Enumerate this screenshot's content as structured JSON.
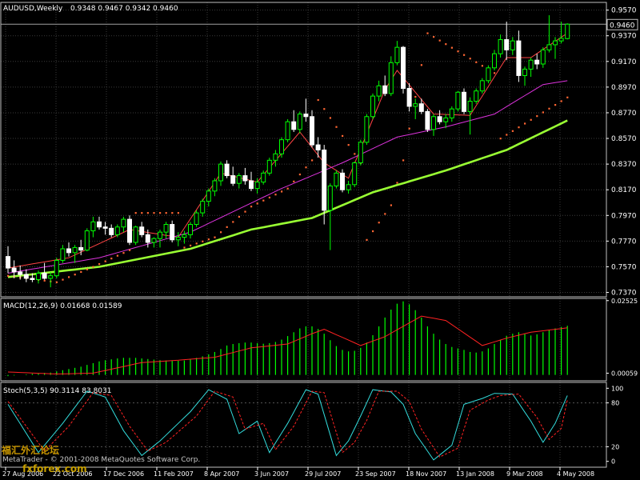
{
  "chart_data": [
    {
      "type": "candlestick",
      "title": "AUDUSD,Weekly",
      "ohlc_text": "0.9348 0.9467 0.9342 0.9460",
      "current_price": 0.946,
      "current_price_label": "0.9460",
      "ylim": [
        0.7336,
        0.963
      ],
      "y_ticks": [
        "0.9570",
        "0.9370",
        "0.9170",
        "0.8970",
        "0.8770",
        "0.8570",
        "0.8370",
        "0.8170",
        "0.7970",
        "0.7770",
        "0.7570",
        "0.7370"
      ],
      "candle_colors": {
        "up": "#00ff00",
        "down": "#ffffff"
      },
      "candles": [
        [
          0.765,
          0.773,
          0.752,
          0.756
        ],
        [
          0.756,
          0.762,
          0.748,
          0.753
        ],
        [
          0.753,
          0.758,
          0.747,
          0.751
        ],
        [
          0.751,
          0.755,
          0.745,
          0.748
        ],
        [
          0.748,
          0.752,
          0.745,
          0.747
        ],
        [
          0.747,
          0.754,
          0.744,
          0.752
        ],
        [
          0.752,
          0.76,
          0.747,
          0.748
        ],
        [
          0.748,
          0.753,
          0.741,
          0.75
        ],
        [
          0.75,
          0.764,
          0.748,
          0.762
        ],
        [
          0.762,
          0.774,
          0.76,
          0.771
        ],
        [
          0.771,
          0.776,
          0.765,
          0.768
        ],
        [
          0.768,
          0.774,
          0.76,
          0.772
        ],
        [
          0.772,
          0.778,
          0.766,
          0.77
        ],
        [
          0.77,
          0.787,
          0.769,
          0.785
        ],
        [
          0.785,
          0.796,
          0.78,
          0.792
        ],
        [
          0.792,
          0.796,
          0.786,
          0.788
        ],
        [
          0.788,
          0.792,
          0.782,
          0.787
        ],
        [
          0.787,
          0.79,
          0.78,
          0.782
        ],
        [
          0.782,
          0.79,
          0.78,
          0.788
        ],
        [
          0.788,
          0.796,
          0.784,
          0.794
        ],
        [
          0.794,
          0.797,
          0.774,
          0.776
        ],
        [
          0.776,
          0.789,
          0.774,
          0.788
        ],
        [
          0.788,
          0.792,
          0.78,
          0.782
        ],
        [
          0.782,
          0.786,
          0.772,
          0.776
        ],
        [
          0.776,
          0.78,
          0.772,
          0.779
        ],
        [
          0.779,
          0.786,
          0.772,
          0.784
        ],
        [
          0.784,
          0.792,
          0.779,
          0.79
        ],
        [
          0.79,
          0.793,
          0.776,
          0.778
        ],
        [
          0.778,
          0.784,
          0.773,
          0.78
        ],
        [
          0.78,
          0.785,
          0.775,
          0.782
        ],
        [
          0.782,
          0.792,
          0.779,
          0.79
        ],
        [
          0.79,
          0.801,
          0.788,
          0.799
        ],
        [
          0.799,
          0.81,
          0.796,
          0.808
        ],
        [
          0.808,
          0.818,
          0.804,
          0.816
        ],
        [
          0.816,
          0.826,
          0.812,
          0.824
        ],
        [
          0.824,
          0.839,
          0.82,
          0.837
        ],
        [
          0.837,
          0.84,
          0.826,
          0.828
        ],
        [
          0.828,
          0.835,
          0.82,
          0.822
        ],
        [
          0.822,
          0.83,
          0.818,
          0.828
        ],
        [
          0.828,
          0.834,
          0.821,
          0.824
        ],
        [
          0.824,
          0.831,
          0.816,
          0.818
        ],
        [
          0.818,
          0.826,
          0.814,
          0.823
        ],
        [
          0.823,
          0.832,
          0.821,
          0.83
        ],
        [
          0.83,
          0.842,
          0.828,
          0.84
        ],
        [
          0.84,
          0.848,
          0.835,
          0.845
        ],
        [
          0.845,
          0.858,
          0.842,
          0.856
        ],
        [
          0.856,
          0.872,
          0.854,
          0.87
        ],
        [
          0.87,
          0.879,
          0.862,
          0.864
        ],
        [
          0.864,
          0.878,
          0.861,
          0.876
        ],
        [
          0.876,
          0.888,
          0.87,
          0.874
        ],
        [
          0.874,
          0.879,
          0.85,
          0.852
        ],
        [
          0.852,
          0.858,
          0.842,
          0.848
        ],
        [
          0.848,
          0.852,
          0.79,
          0.801
        ],
        [
          0.801,
          0.822,
          0.77,
          0.82
        ],
        [
          0.82,
          0.832,
          0.818,
          0.83
        ],
        [
          0.83,
          0.833,
          0.815,
          0.817
        ],
        [
          0.817,
          0.824,
          0.814,
          0.821
        ],
        [
          0.821,
          0.839,
          0.819,
          0.838
        ],
        [
          0.838,
          0.856,
          0.836,
          0.854
        ],
        [
          0.854,
          0.876,
          0.852,
          0.874
        ],
        [
          0.874,
          0.892,
          0.872,
          0.89
        ],
        [
          0.89,
          0.902,
          0.886,
          0.898
        ],
        [
          0.898,
          0.906,
          0.89,
          0.892
        ],
        [
          0.892,
          0.921,
          0.89,
          0.916
        ],
        [
          0.916,
          0.933,
          0.914,
          0.928
        ],
        [
          0.928,
          0.929,
          0.892,
          0.896
        ],
        [
          0.896,
          0.9,
          0.878,
          0.882
        ],
        [
          0.882,
          0.888,
          0.872,
          0.884
        ],
        [
          0.884,
          0.888,
          0.876,
          0.878
        ],
        [
          0.878,
          0.88,
          0.862,
          0.864
        ],
        [
          0.864,
          0.876,
          0.859,
          0.874
        ],
        [
          0.874,
          0.879,
          0.868,
          0.87
        ],
        [
          0.87,
          0.876,
          0.865,
          0.873
        ],
        [
          0.873,
          0.882,
          0.87,
          0.88
        ],
        [
          0.88,
          0.894,
          0.878,
          0.893
        ],
        [
          0.893,
          0.896,
          0.876,
          0.878
        ],
        [
          0.878,
          0.889,
          0.86,
          0.886
        ],
        [
          0.886,
          0.896,
          0.884,
          0.894
        ],
        [
          0.894,
          0.904,
          0.892,
          0.902
        ],
        [
          0.902,
          0.914,
          0.9,
          0.912
        ],
        [
          0.912,
          0.926,
          0.91,
          0.923
        ],
        [
          0.923,
          0.938,
          0.92,
          0.934
        ],
        [
          0.934,
          0.948,
          0.918,
          0.926
        ],
        [
          0.926,
          0.936,
          0.922,
          0.933
        ],
        [
          0.933,
          0.941,
          0.901,
          0.906
        ],
        [
          0.906,
          0.913,
          0.898,
          0.911
        ],
        [
          0.911,
          0.92,
          0.905,
          0.918
        ],
        [
          0.918,
          0.923,
          0.911,
          0.915
        ],
        [
          0.915,
          0.928,
          0.912,
          0.926
        ],
        [
          0.926,
          0.953,
          0.924,
          0.93
        ],
        [
          0.93,
          0.936,
          0.919,
          0.933
        ],
        [
          0.933,
          0.948,
          0.931,
          0.935
        ],
        [
          0.9348,
          0.9467,
          0.9342,
          0.946
        ]
      ],
      "moving_averages": [
        {
          "color": "#ff4444",
          "anchors": [
            [
              0,
              0.756
            ],
            [
              10,
              0.764
            ],
            [
              20,
              0.786
            ],
            [
              28,
              0.78
            ],
            [
              35,
              0.83
            ],
            [
              41,
              0.823
            ],
            [
              48,
              0.862
            ],
            [
              52,
              0.838
            ],
            [
              56,
              0.826
            ],
            [
              62,
              0.895
            ],
            [
              64,
              0.91
            ],
            [
              70,
              0.876
            ],
            [
              76,
              0.875
            ],
            [
              82,
              0.92
            ],
            [
              86,
              0.92
            ],
            [
              92,
              0.939
            ]
          ]
        },
        {
          "color": "#dd33dd",
          "anchors": [
            [
              0,
              0.752
            ],
            [
              15,
              0.764
            ],
            [
              30,
              0.784
            ],
            [
              45,
              0.818
            ],
            [
              55,
              0.838
            ],
            [
              64,
              0.858
            ],
            [
              72,
              0.866
            ],
            [
              80,
              0.876
            ],
            [
              88,
              0.899
            ],
            [
              92,
              0.902
            ]
          ]
        },
        {
          "color": "#99ff33",
          "anchors": [
            [
              0,
              0.749
            ],
            [
              15,
              0.757
            ],
            [
              30,
              0.771
            ],
            [
              40,
              0.786
            ],
            [
              50,
              0.795
            ],
            [
              60,
              0.815
            ],
            [
              72,
              0.832
            ],
            [
              82,
              0.848
            ],
            [
              92,
              0.871
            ]
          ]
        }
      ],
      "parabolic_sar": {
        "color": "#ff6633",
        "anchors": [
          [
            0,
            0.75
          ],
          [
            8,
            0.745
          ],
          [
            14,
            0.757
          ],
          [
            20,
            0.77
          ],
          [
            21,
            0.799
          ],
          [
            28,
            0.799
          ],
          [
            29,
            0.772
          ],
          [
            34,
            0.78
          ],
          [
            40,
            0.804
          ],
          [
            46,
            0.818
          ],
          [
            50,
            0.84
          ],
          [
            51,
            0.887
          ],
          [
            58,
            0.838
          ],
          [
            59,
            0.778
          ],
          [
            63,
            0.805
          ],
          [
            65,
            0.84
          ],
          [
            69,
            0.939
          ],
          [
            80,
            0.908
          ],
          [
            81,
            0.857
          ],
          [
            92,
            0.889
          ]
        ],
        "gaps": [
          21,
          29,
          51,
          59,
          69,
          81
        ]
      }
    },
    {
      "type": "histogram+line",
      "title": "MACD(12,26,9) 0.01668 0.01589",
      "ylim": [
        -0.002,
        0.026
      ],
      "y_ticks": [
        "0.02525",
        "0.00059"
      ],
      "histogram_color": "#00ff00",
      "signal_color": "#ff2222",
      "histogram": [
        -0.0004,
        -0.0002,
        0,
        0.0002,
        0.0004,
        0.0006,
        0.0007,
        0.0008,
        0.0012,
        0.0016,
        0.002,
        0.0024,
        0.0028,
        0.0034,
        0.004,
        0.0046,
        0.005,
        0.0053,
        0.0056,
        0.0058,
        0.0058,
        0.0058,
        0.0056,
        0.0054,
        0.0052,
        0.005,
        0.0049,
        0.0048,
        0.0048,
        0.0049,
        0.0053,
        0.0058,
        0.0063,
        0.007,
        0.0078,
        0.0088,
        0.01,
        0.0105,
        0.0108,
        0.011,
        0.011,
        0.0108,
        0.0106,
        0.0108,
        0.0112,
        0.012,
        0.0132,
        0.0145,
        0.0158,
        0.0165,
        0.0165,
        0.0156,
        0.014,
        0.0118,
        0.0098,
        0.0085,
        0.008,
        0.0082,
        0.0092,
        0.011,
        0.0135,
        0.0165,
        0.0195,
        0.0222,
        0.0242,
        0.025,
        0.024,
        0.022,
        0.0195,
        0.0165,
        0.014,
        0.012,
        0.0105,
        0.0095,
        0.009,
        0.0085,
        0.0078,
        0.0076,
        0.008,
        0.009,
        0.0105,
        0.012,
        0.0133,
        0.014,
        0.0145,
        0.014,
        0.0134,
        0.0138,
        0.0145,
        0.0152,
        0.0158,
        0.0163,
        0.0167
      ],
      "signal_anchors": [
        [
          0,
          0.001
        ],
        [
          8,
          0.0003
        ],
        [
          14,
          0.0006
        ],
        [
          22,
          0.0042
        ],
        [
          28,
          0.005
        ],
        [
          34,
          0.006
        ],
        [
          40,
          0.0092
        ],
        [
          46,
          0.0105
        ],
        [
          50,
          0.014
        ],
        [
          52,
          0.0155
        ],
        [
          58,
          0.01
        ],
        [
          62,
          0.013
        ],
        [
          68,
          0.02
        ],
        [
          72,
          0.0185
        ],
        [
          78,
          0.01
        ],
        [
          82,
          0.0125
        ],
        [
          86,
          0.0145
        ],
        [
          92,
          0.016
        ]
      ]
    },
    {
      "type": "line",
      "title": "Stoch(5,3,5) 90.3114 83.8031",
      "ylim": [
        -8,
        108
      ],
      "y_ticks": [
        "100",
        "80",
        "20",
        "0"
      ],
      "main_color": "#33dddd",
      "signal_color": "#ff2222",
      "main_anchors": [
        [
          0,
          78
        ],
        [
          5,
          12
        ],
        [
          9,
          52
        ],
        [
          13,
          96
        ],
        [
          16,
          88
        ],
        [
          19,
          42
        ],
        [
          22,
          8
        ],
        [
          25,
          28
        ],
        [
          30,
          68
        ],
        [
          33,
          98
        ],
        [
          36,
          85
        ],
        [
          38,
          38
        ],
        [
          41,
          55
        ],
        [
          43,
          12
        ],
        [
          46,
          52
        ],
        [
          49,
          98
        ],
        [
          51,
          92
        ],
        [
          54,
          8
        ],
        [
          56,
          28
        ],
        [
          58,
          62
        ],
        [
          60,
          98
        ],
        [
          63,
          95
        ],
        [
          65,
          78
        ],
        [
          67,
          38
        ],
        [
          70,
          2
        ],
        [
          73,
          22
        ],
        [
          75,
          78
        ],
        [
          78,
          86
        ],
        [
          80,
          93
        ],
        [
          83,
          92
        ],
        [
          86,
          55
        ],
        [
          88,
          26
        ],
        [
          90,
          52
        ],
        [
          92,
          90
        ]
      ],
      "signal_anchors": [
        [
          0,
          82
        ],
        [
          6,
          14
        ],
        [
          10,
          48
        ],
        [
          14,
          94
        ],
        [
          17,
          90
        ],
        [
          20,
          48
        ],
        [
          23,
          14
        ],
        [
          26,
          26
        ],
        [
          31,
          62
        ],
        [
          34,
          96
        ],
        [
          37,
          88
        ],
        [
          39,
          44
        ],
        [
          42,
          52
        ],
        [
          44,
          16
        ],
        [
          47,
          48
        ],
        [
          50,
          96
        ],
        [
          52,
          94
        ],
        [
          55,
          12
        ],
        [
          57,
          26
        ],
        [
          59,
          56
        ],
        [
          61,
          96
        ],
        [
          64,
          96
        ],
        [
          66,
          82
        ],
        [
          68,
          44
        ],
        [
          71,
          6
        ],
        [
          74,
          18
        ],
        [
          76,
          70
        ],
        [
          79,
          84
        ],
        [
          81,
          90
        ],
        [
          84,
          92
        ],
        [
          87,
          60
        ],
        [
          89,
          30
        ],
        [
          91,
          45
        ],
        [
          92,
          84
        ]
      ]
    }
  ],
  "time_axis": [
    "27 Aug 2006",
    "22 Oct 2006",
    "17 Dec 2006",
    "11 Feb 2007",
    "8 Apr 2007",
    "3 Jun 2007",
    "29 Jul 2007",
    "23 Sep 2007",
    "18 Nov 2007",
    "13 Jan 2008",
    "9 Mar 2008",
    "4 May 2008"
  ],
  "watermark": {
    "copyright": "MetaTrader - © 2001-2008 MetaQuotes Software Corp.",
    "site_cn": "福汇外汇论坛",
    "site_url": "fxforex.com"
  }
}
